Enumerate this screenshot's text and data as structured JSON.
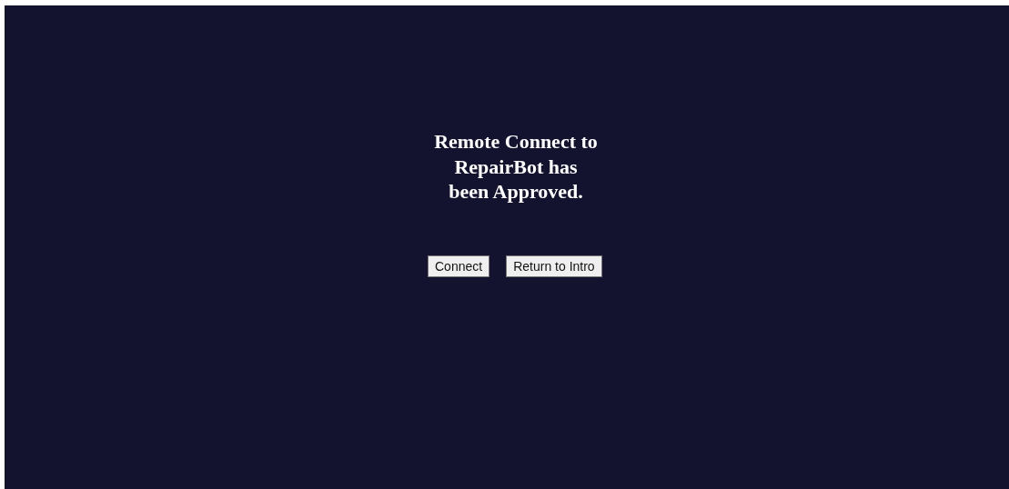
{
  "heading": "Remote Connect to RepairBot has been Approved.",
  "buttons": [
    {
      "label": "Connect"
    },
    {
      "label": "Return to Intro"
    }
  ]
}
